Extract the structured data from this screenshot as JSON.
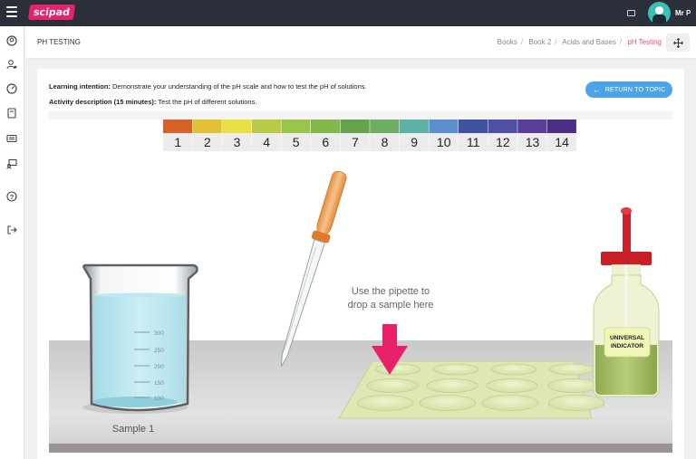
{
  "topbar": {
    "logo": "scipad",
    "user_name": "Mr P",
    "icons": [
      "menu-icon",
      "card-icon",
      "avatar"
    ]
  },
  "sidebar": {
    "icons": [
      "account-icon",
      "user-settings-icon",
      "dashboard-icon",
      "book-icon",
      "class-icon",
      "presentation-icon",
      "help-icon",
      "logout-icon"
    ]
  },
  "header": {
    "title": "PH TESTING",
    "breadcrumbs": [
      "Books",
      "Book 2",
      "Acids and Bases",
      "pH Testing"
    ]
  },
  "activity": {
    "intent_label": "Learning intention:",
    "intent_text": "Demonstrate your understanding of the pH scale and how to test the pH of solutions.",
    "desc_label": "Activity description (15 minutes):",
    "desc_text": "Test the pH of different solutions.",
    "return_label": "RETURN TO TOPIC"
  },
  "ph_scale": {
    "numbers": [
      "1",
      "2",
      "3",
      "4",
      "5",
      "6",
      "7",
      "8",
      "9",
      "10",
      "11",
      "12",
      "13",
      "14"
    ],
    "colors": [
      "#d6622a",
      "#e2c234",
      "#e8e043",
      "#b9c948",
      "#9bc44a",
      "#84b84a",
      "#66a34c",
      "#6cae62",
      "#5fb0a5",
      "#5b8fcd",
      "#3f529f",
      "#4f4fa3",
      "#58409a",
      "#4a2f85"
    ]
  },
  "scene": {
    "beaker_marks": [
      "300",
      "250",
      "200",
      "150",
      "100"
    ],
    "sample_label": "Sample 1",
    "instruction_line1": "Use the pipette to",
    "instruction_line2": "drop a sample here",
    "indicator_line1": "UNIVERSAL",
    "indicator_line2": "INDICATOR"
  }
}
